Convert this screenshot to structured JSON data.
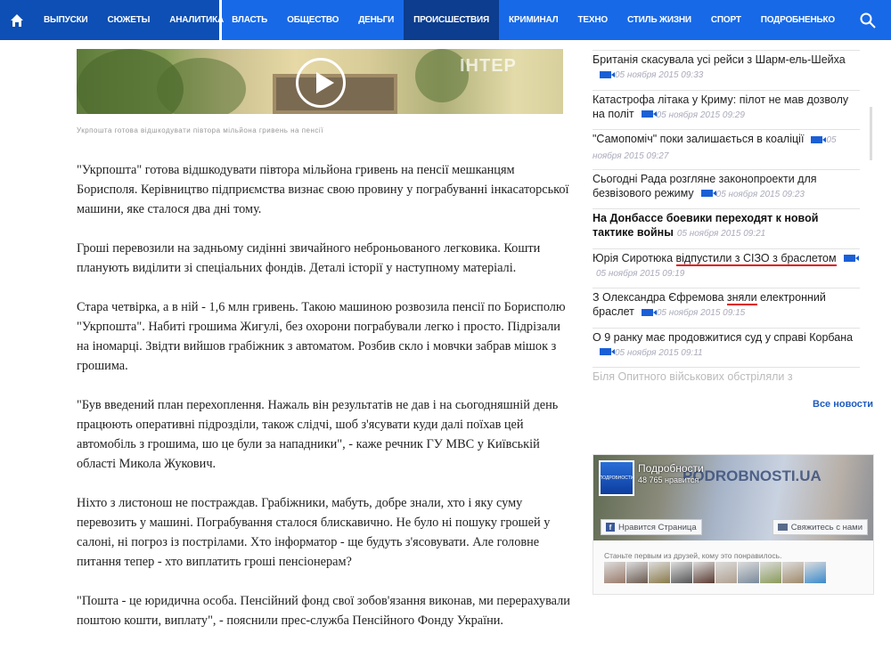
{
  "nav": {
    "left": [
      "ВЫПУСКИ",
      "СЮЖЕТЫ",
      "АНАЛИТИКА"
    ],
    "right": [
      "ВЛАСТЬ",
      "ОБЩЕСТВО",
      "ДЕНЬГИ",
      "ПРОИСШЕСТВИЯ",
      "КРИМИНАЛ",
      "ТЕХНО",
      "СТИЛЬ ЖИЗНИ",
      "СПОРТ",
      "ПОДРОБНЕНЬКО"
    ],
    "active": "ПРОИСШЕСТВИЯ"
  },
  "media": {
    "watermark": "ІНТЕР",
    "caption": "Укрпошта готова відшкодувати півтора мільйона гривень на пенсії"
  },
  "article": {
    "paragraphs": [
      "\"Укрпошта\" готова відшкодувати півтора мільйона гривень на пенсії мешканцям Борисполя. Керівництво підприємства визнає свою провину у пограбуванні інкасаторської машини, яке сталося два дні тому.",
      "Гроші перевозили на задньому сидінні звичайного неброньованого легковика. Кошти планують виділити зі спеціальних фондів. Деталі історії у наступному матеріалі.",
      "Стара четвірка, а в ній - 1,6 млн гривень. Такою машиною розвозила пенсії по Борисполю \"Укрпошта\". Набиті грошима Жигулі, без охорони пограбували легко і просто. Підрізали на іномарці. Звідти вийшов грабіжник з автоматом. Розбив скло і мовчки забрав мішок з грошима.",
      "\"Був введений план перехоплення. Нажаль він результатів не дав і на сьогодняшній день працюють оперативні підрозділи, також слідчі, шоб з'ясувати куди далі поїхав цей автомобіль з грошима, шо це були за нападники\", - каже речник ГУ МВС у Київській області Микола Жукович.",
      "Ніхто з листонош не постраждав. Грабіжники, мабуть, добре знали, хто і яку суму перевозить у машині. Пограбування сталося блискавично. Не було ні пошуку грошей у салоні, ні погроз із пострілами. Хто інформатор - ще будуть з'ясовувати. Але головне питання тепер - хто виплатить гроші пенсіонерам?",
      "\"Пошта - це юридична особа. Пенсійний фонд свої зобов'язання виконав, ми перерахували поштою кошти, виплату\", - пояснили прес-служба Пенсійного Фонду України."
    ]
  },
  "sidebar": {
    "items": [
      {
        "parts": [
          "Британія скасувала усі рейси з Шарм-ель-Шейха"
        ],
        "hl": -1,
        "video": true,
        "date": "05 ноября 2015 09:33",
        "bold": false
      },
      {
        "parts": [
          "Катастрофа літака у Криму: пілот не мав дозволу на політ"
        ],
        "hl": -1,
        "video": true,
        "date": "05 ноября 2015 09:29",
        "bold": false
      },
      {
        "parts": [
          "\"Самопоміч\" поки залишається в коаліції"
        ],
        "hl": -1,
        "video": true,
        "date": "05 ноября 2015 09:27",
        "bold": false
      },
      {
        "parts": [
          "Сьогодні Рада розгляне законопроекти для безвізового режиму"
        ],
        "hl": -1,
        "video": true,
        "date": "05 ноября 2015 09:23",
        "bold": false
      },
      {
        "parts": [
          "На Донбассе боевики переходят к новой тактике войны"
        ],
        "hl": -1,
        "video": false,
        "date": "05 ноября 2015 09:21",
        "bold": true
      },
      {
        "parts": [
          "Юрія Сиротюка ",
          "відпустили з СІЗО з браслетом"
        ],
        "hl": 1,
        "video": true,
        "date": "05 ноября 2015 09:19",
        "bold": false
      },
      {
        "parts": [
          "З Олександра Єфремова ",
          "зняли",
          " електронний браслет"
        ],
        "hl": 1,
        "video": true,
        "date": "05 ноября 2015 09:15",
        "bold": false
      },
      {
        "parts": [
          "О 9 ранку має продовжитися суд у справі Корбана"
        ],
        "hl": -1,
        "video": true,
        "date": "05 ноября 2015 09:11",
        "bold": false
      }
    ],
    "faded_item": "Біля Опитного військових обстріляли з",
    "all_news": "Все новости"
  },
  "facebook": {
    "page_name": "Подробности",
    "likes": "48 765 нравится",
    "watermark": "PODROBNOSTI.UA",
    "logo_text": "ПОДРОБНОСТИ",
    "like_button": "Нравится Страница",
    "contact_button": "Свяжитесь с нами",
    "friends_text": "Станьте первым из друзей, кому это понравилось.",
    "face_colors": [
      "#9a7a6a",
      "#6a5a50",
      "#8a7a4a",
      "#555",
      "#5a3a30",
      "#b0a090",
      "#7a8a9a",
      "#8a9a5a",
      "#a08a6a",
      "#3a8acc"
    ]
  },
  "colors": {
    "nav": "#1769e8",
    "nav_dark": "#0d4fb4",
    "active": "#0c3d8e",
    "video": "#1a5fd6",
    "highlight": "#dd1111"
  }
}
